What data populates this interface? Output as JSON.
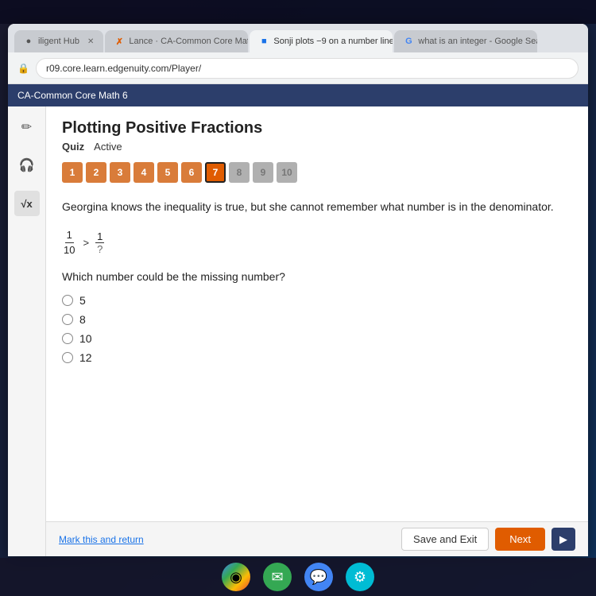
{
  "desktop": {
    "top_bar_height": 30
  },
  "browser": {
    "tabs": [
      {
        "id": "tab1",
        "label": "iligent Hub",
        "active": false,
        "favicon": "●"
      },
      {
        "id": "tab2",
        "label": "Lance · CA-Common Core Math",
        "active": false,
        "favicon": "✗"
      },
      {
        "id": "tab3",
        "label": "Sonji plots −9 on a number line",
        "active": true,
        "favicon": "■"
      },
      {
        "id": "tab4",
        "label": "what is an integer - Google Sear...",
        "active": false,
        "favicon": "G"
      }
    ],
    "url": "r09.core.learn.edgenuity.com/Player/"
  },
  "app": {
    "course": "CA-Common Core Math 6",
    "lesson_title": "Plotting Positive Fractions",
    "quiz_label": "Quiz",
    "quiz_status": "Active"
  },
  "question_numbers": [
    {
      "num": "1",
      "state": "completed"
    },
    {
      "num": "2",
      "state": "completed"
    },
    {
      "num": "3",
      "state": "completed"
    },
    {
      "num": "4",
      "state": "completed"
    },
    {
      "num": "5",
      "state": "completed"
    },
    {
      "num": "6",
      "state": "completed"
    },
    {
      "num": "7",
      "state": "current"
    },
    {
      "num": "8",
      "state": "locked"
    },
    {
      "num": "9",
      "state": "locked"
    },
    {
      "num": "10",
      "state": "locked"
    }
  ],
  "question": {
    "text": "Georgina knows the inequality is true, but she cannot remember what number is in the denominator.",
    "inequality_left_numerator": "1",
    "inequality_left_denominator": "10",
    "inequality_operator": ">",
    "inequality_right_numerator": "1",
    "inequality_right_denominator": "?",
    "which_number_text": "Which number could be the missing number?",
    "options": [
      {
        "value": "5",
        "label": "5"
      },
      {
        "value": "8",
        "label": "8"
      },
      {
        "value": "10",
        "label": "10"
      },
      {
        "value": "12",
        "label": "12"
      }
    ]
  },
  "footer": {
    "mark_return_label": "Mark this and return",
    "save_exit_label": "Save and Exit",
    "next_label": "Next"
  },
  "sidebar": {
    "icons": [
      {
        "name": "pencil",
        "symbol": "✏"
      },
      {
        "name": "headphones",
        "symbol": "🎧"
      },
      {
        "name": "calculator",
        "symbol": "√x"
      }
    ]
  },
  "taskbar": {
    "icons": [
      {
        "name": "chrome",
        "symbol": "◉"
      },
      {
        "name": "mail",
        "symbol": "✉"
      },
      {
        "name": "chat",
        "symbol": "💬"
      },
      {
        "name": "settings",
        "symbol": "⚙"
      }
    ]
  }
}
